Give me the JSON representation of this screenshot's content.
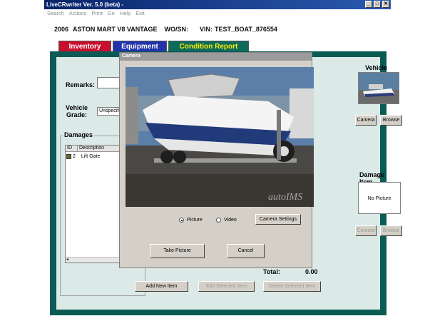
{
  "window": {
    "title": "LiveCRwriter Ver. 5.0 (beta) -",
    "controls": [
      "_",
      "□",
      "✕"
    ]
  },
  "menu": [
    "Search",
    "Actions",
    "Print",
    "Go",
    "Help",
    "Exit"
  ],
  "vehicle_info": {
    "year": "2006",
    "model": "ASTON MART V8 VANTAGE",
    "wo_label": "WO/SN:",
    "vin_label": "VIN:",
    "vin": "TEST_BOAT_876554"
  },
  "tabs": {
    "inventory": "Inventory",
    "equipment": "Equipment",
    "condition_report": "Condition Report"
  },
  "form": {
    "remarks_label": "Remarks:",
    "grade_label_1": "Vehicle",
    "grade_label_2": "Grade:",
    "grade_value": "Unspecifie"
  },
  "damages": {
    "legend": "Damages",
    "columns": [
      "ID",
      "Description"
    ],
    "rows": [
      {
        "id": "2",
        "description": "Lift Gate"
      }
    ],
    "total_label": "Total:",
    "total_value": "0.00",
    "add_button": "Add New Item",
    "edit_button": "Edit Selected Item",
    "delete_button": "Delete Selected Item"
  },
  "vehicle_photo": {
    "label": "Vehicle",
    "camera_button": "Camera",
    "browse_button": "Browse"
  },
  "damage_photo": {
    "label": "Damage Item",
    "placeholder": "No Picture",
    "camera_button": "Camera",
    "browse_button": "Browse"
  },
  "camera_dialog": {
    "title": "Camera",
    "watermark": "autoIMS",
    "picture_option": "Picture",
    "video_option": "Video",
    "selected_option": "Picture",
    "settings_button": "Camera Settings",
    "take_button": "Take Picture",
    "cancel_button": "Cancel"
  },
  "colors": {
    "inventory_tab": "#c8102e",
    "equipment_tab": "#2233aa",
    "condition_tab": "#0d6b5c",
    "condition_tab_text": "#ffea00",
    "panel_border": "#0b5b55",
    "panel_fill": "#dbe9e7"
  }
}
